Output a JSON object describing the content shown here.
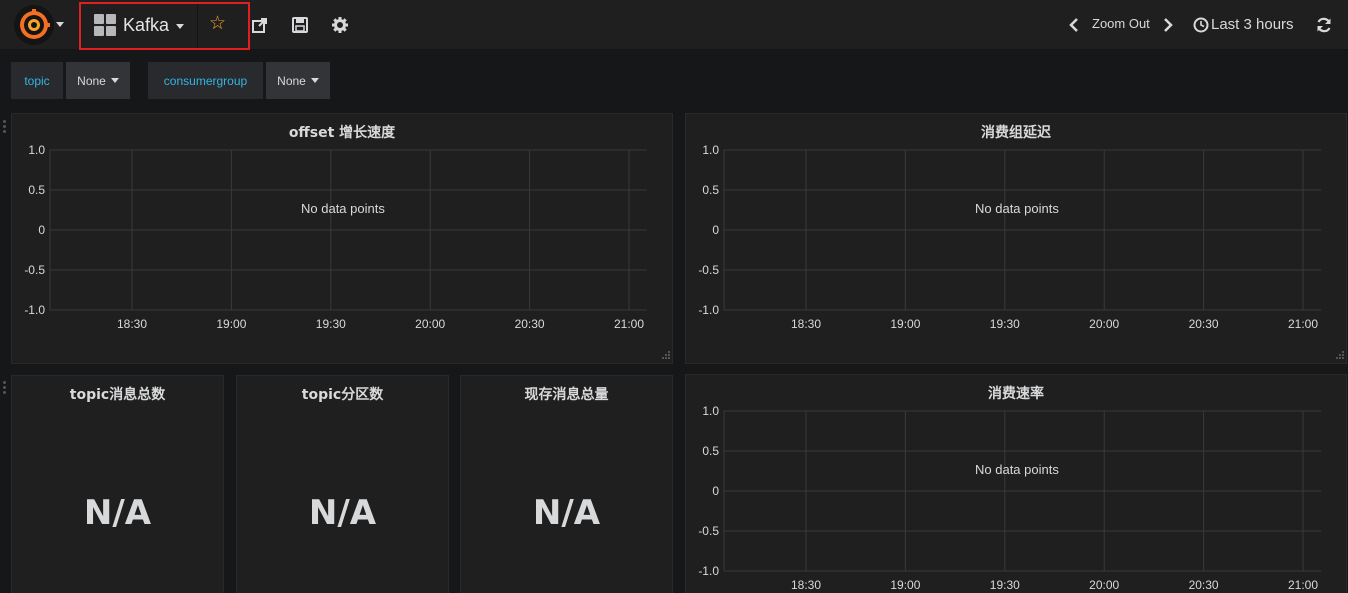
{
  "navbar": {
    "dashboard_title": "Kafka",
    "zoom_out_label": "Zoom Out",
    "time_range_label": "Last 3 hours",
    "colors": {
      "accent_star": "#f7a428",
      "highlight_box": "#e02020"
    }
  },
  "template_variables": [
    {
      "label": "topic",
      "value": "None"
    },
    {
      "label": "consumergroup",
      "value": "None"
    }
  ],
  "panels": {
    "offset_growth": {
      "title": "offset 增长速度",
      "nodata": "No data points",
      "y_ticks": [
        "1.0",
        "0.5",
        "0",
        "-0.5",
        "-1.0"
      ],
      "x_ticks": [
        "18:30",
        "19:00",
        "19:30",
        "20:00",
        "20:30",
        "21:00"
      ]
    },
    "consumer_lag": {
      "title": "消费组延迟",
      "nodata": "No data points",
      "y_ticks": [
        "1.0",
        "0.5",
        "0",
        "-0.5",
        "-1.0"
      ],
      "x_ticks": [
        "18:30",
        "19:00",
        "19:30",
        "20:00",
        "20:30",
        "21:00"
      ]
    },
    "topic_total": {
      "title": "topic消息总数",
      "value": "N/A"
    },
    "topic_partitions": {
      "title": "topic分区数",
      "value": "N/A"
    },
    "current_total": {
      "title": "现存消息总量",
      "value": "N/A"
    },
    "consume_rate": {
      "title": "消费速率",
      "nodata": "No data points",
      "y_ticks": [
        "1.0",
        "0.5",
        "0",
        "-0.5",
        "-1.0"
      ],
      "x_ticks": [
        "18:30",
        "19:00",
        "19:30",
        "20:00",
        "20:30",
        "21:00"
      ]
    }
  }
}
